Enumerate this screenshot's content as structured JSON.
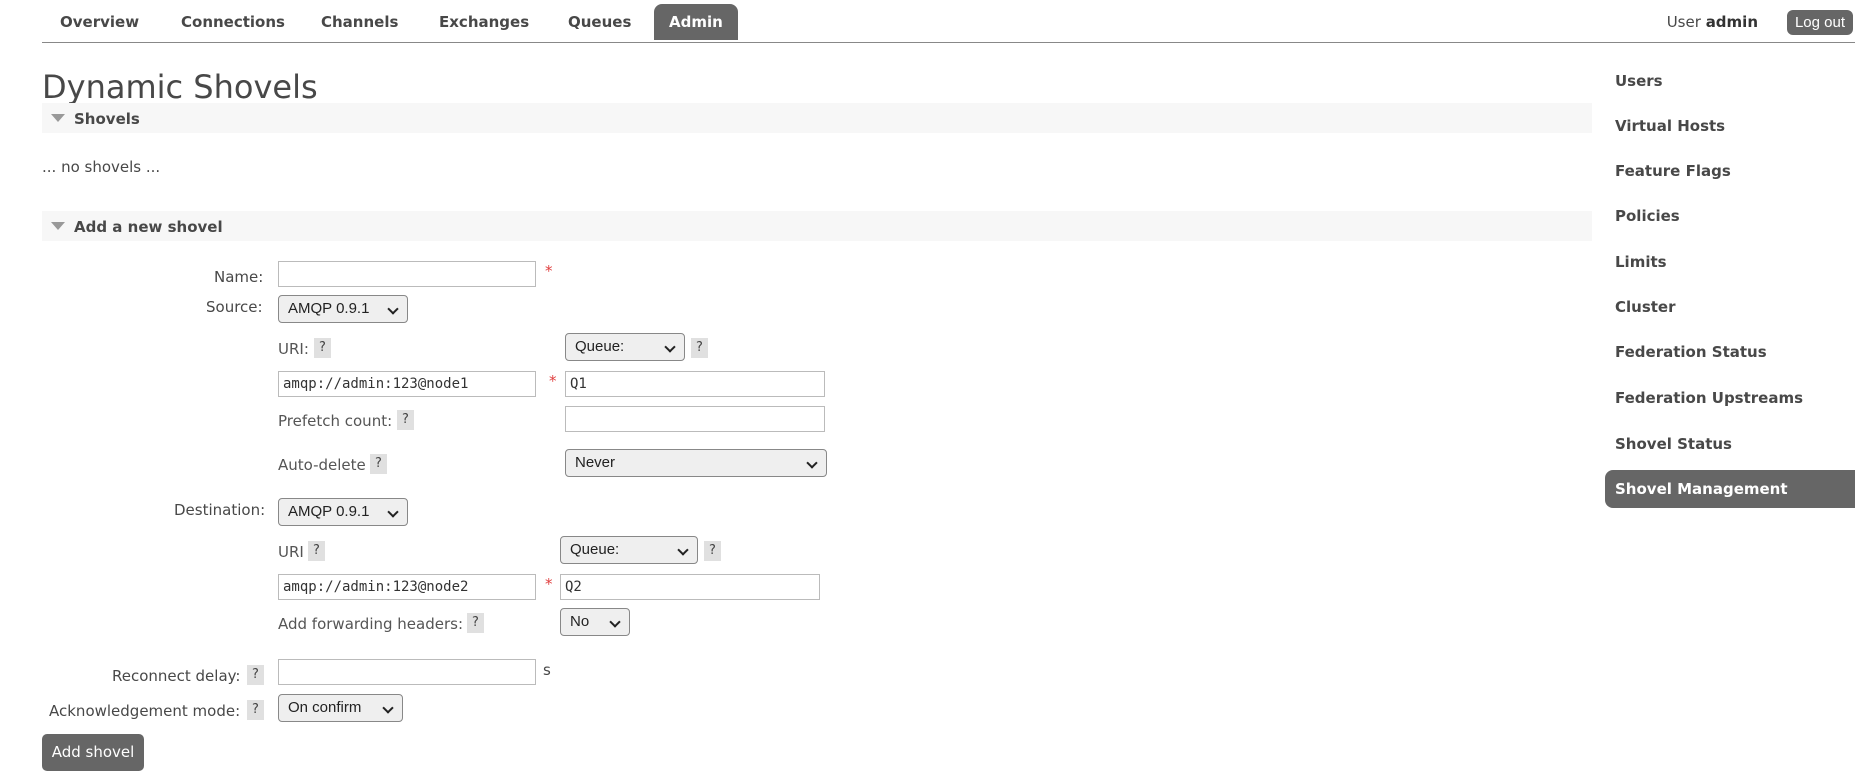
{
  "nav": {
    "tabs": [
      "Overview",
      "Connections",
      "Channels",
      "Exchanges",
      "Queues",
      "Admin"
    ],
    "active": "Admin",
    "user_prefix": "User",
    "user_name": "admin",
    "logout_label": "Log out"
  },
  "page": {
    "title": "Dynamic Shovels",
    "shovels_section": "Shovels",
    "no_shovels": "... no shovels ...",
    "add_section": "Add a new shovel"
  },
  "form": {
    "name_label": "Name:",
    "name_value": "",
    "source_label": "Source:",
    "source_protocol": "AMQP 0.9.1",
    "source_uri_label": "URI:",
    "source_type": "Queue:",
    "source_uri_value": "amqp://admin:123@node1",
    "source_queue_value": "Q1",
    "prefetch_label": "Prefetch count:",
    "prefetch_value": "",
    "auto_delete_label": "Auto-delete",
    "auto_delete_value": "Never",
    "destination_label": "Destination:",
    "destination_protocol": "AMQP 0.9.1",
    "dest_uri_label": "URI",
    "dest_type": "Queue:",
    "dest_uri_value": "amqp://admin:123@node2",
    "dest_queue_value": "Q2",
    "fwd_headers_label": "Add forwarding headers:",
    "fwd_headers_value": "No",
    "reconnect_label": "Reconnect delay:",
    "reconnect_value": "",
    "reconnect_unit": "s",
    "ack_label": "Acknowledgement mode:",
    "ack_value": "On confirm",
    "submit_label": "Add shovel",
    "required_mark": "*",
    "help_mark": "?"
  },
  "sidebar": {
    "items": [
      "Users",
      "Virtual Hosts",
      "Feature Flags",
      "Policies",
      "Limits",
      "Cluster",
      "Federation Status",
      "Federation Upstreams",
      "Shovel Status",
      "Shovel Management"
    ],
    "active": "Shovel Management"
  },
  "colors": {
    "accent": "#666666",
    "required": "#e04040",
    "section_bg": "#f7f7f7"
  }
}
